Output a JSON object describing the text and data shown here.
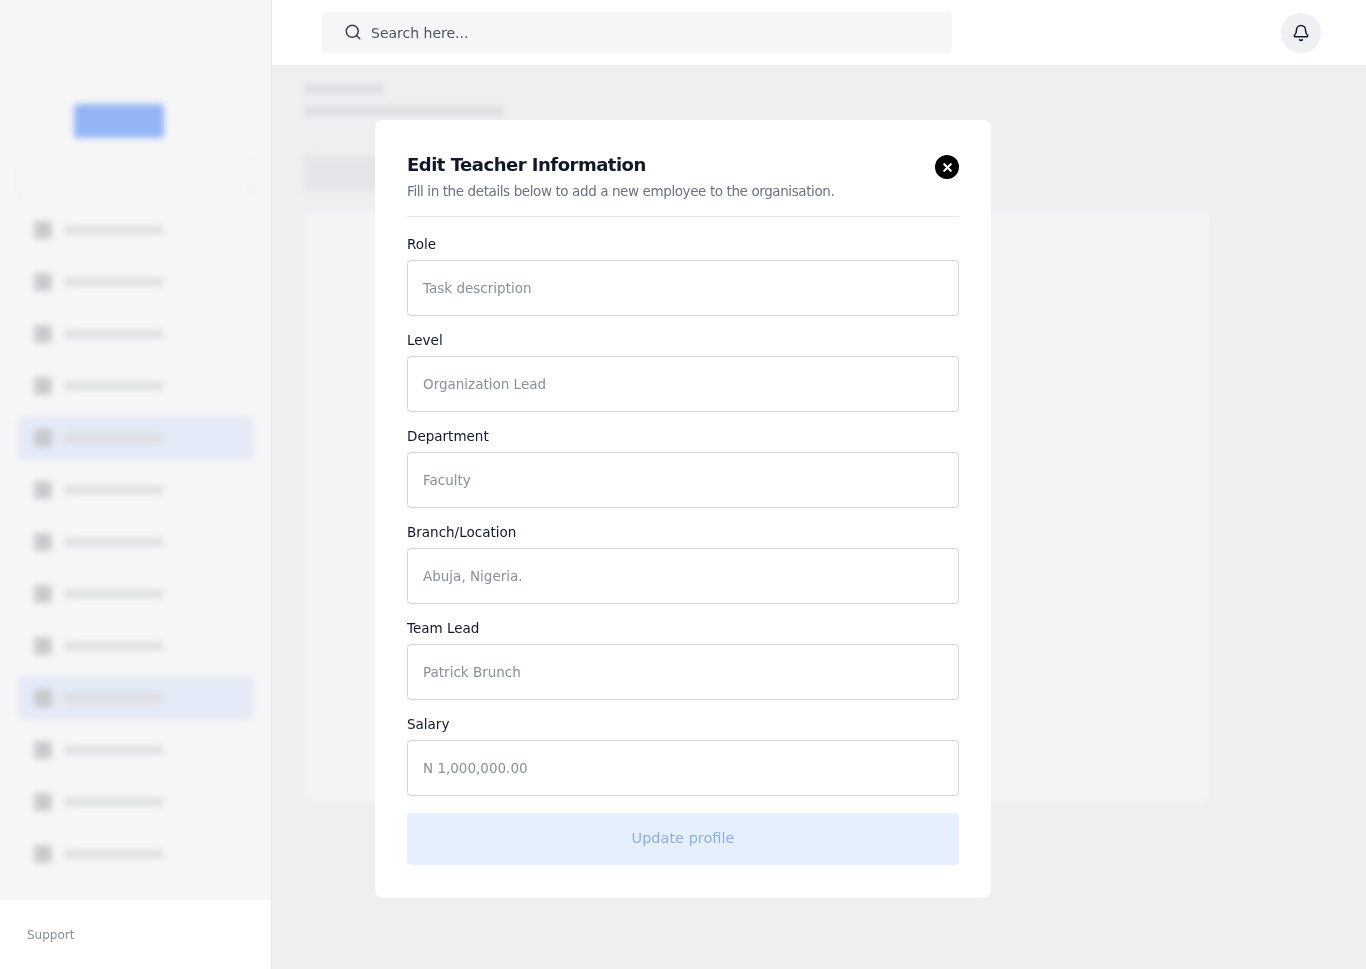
{
  "search": {
    "placeholder": "Search here..."
  },
  "sidebar": {
    "footer_link": "Support"
  },
  "dialog": {
    "title": "Edit Teacher Information",
    "subtitle": "Fill in the details below to add a new employee to the organisation.",
    "fields": [
      {
        "label": "Role",
        "placeholder": "Task description"
      },
      {
        "label": "Level",
        "placeholder": "Organization Lead"
      },
      {
        "label": "Department",
        "placeholder": "Faculty"
      },
      {
        "label": "Branch/Location",
        "placeholder": "Abuja, Nigeria."
      },
      {
        "label": "Team Lead",
        "placeholder": "Patrick Brunch"
      },
      {
        "label": "Salary",
        "placeholder": "N 1,000,000.00"
      }
    ],
    "submit": {
      "label": "Update profile",
      "disabled": true
    }
  }
}
